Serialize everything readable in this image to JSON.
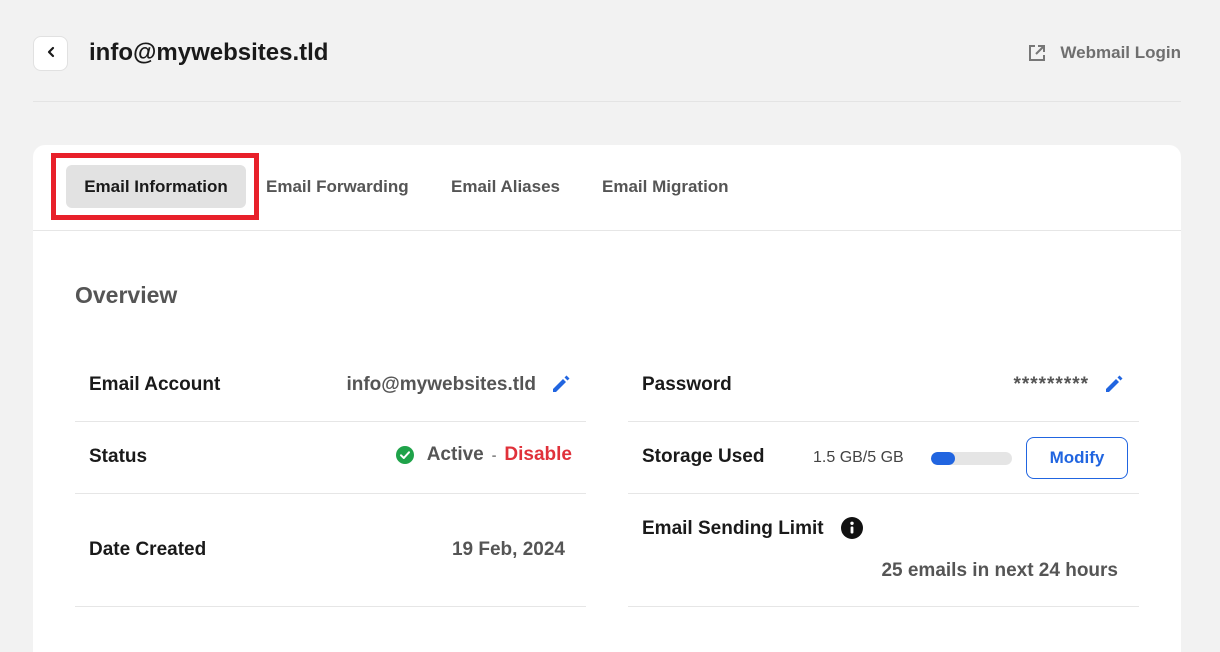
{
  "header": {
    "back_icon": "chevron-left-icon",
    "title": "info@mywebsites.tld",
    "webmail_label": "Webmail Login",
    "webmail_icon": "external-link-icon"
  },
  "tabs": [
    {
      "label": "Email Information",
      "active": true
    },
    {
      "label": "Email Forwarding",
      "active": false
    },
    {
      "label": "Email Aliases",
      "active": false
    },
    {
      "label": "Email Migration",
      "active": false
    }
  ],
  "overview": {
    "title": "Overview",
    "email_account": {
      "label": "Email Account",
      "value": "info@mywebsites.tld",
      "icon": "pencil-icon"
    },
    "password": {
      "label": "Password",
      "value": "*********",
      "icon": "pencil-icon"
    },
    "status": {
      "label": "Status",
      "value": "Active",
      "separator": "-",
      "action": "Disable",
      "icon": "check-circle-icon"
    },
    "storage": {
      "label": "Storage Used",
      "value": "1.5 GB/5 GB",
      "used_fraction": 0.3,
      "button": "Modify"
    },
    "date_created": {
      "label": "Date Created",
      "value": "19 Feb, 2024"
    },
    "sending_limit": {
      "label": "Email Sending Limit",
      "value": "25 emails in next 24 hours",
      "icon": "info-icon"
    }
  },
  "colors": {
    "accent": "#2165e0",
    "danger": "#e0313a",
    "success": "#1fa34a",
    "highlight": "#e8202a"
  }
}
